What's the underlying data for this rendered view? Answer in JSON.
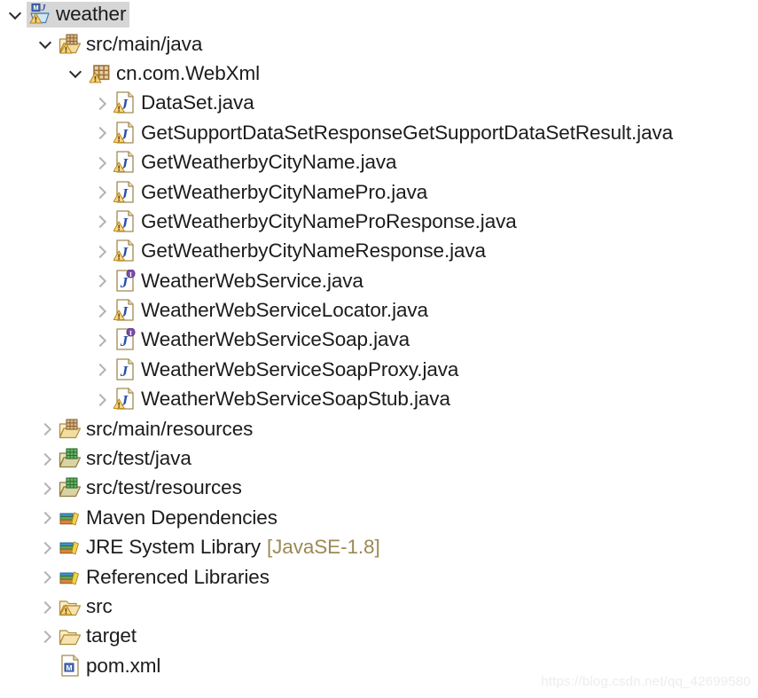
{
  "view": {
    "name": "package-explorer-tree",
    "background": "#ffffff",
    "text_color": "#1c1c1c",
    "selection_color": "#d6d6d6",
    "suffix_color": "#9a8a55"
  },
  "watermark": {
    "text": "https://blog.csdn.net/qq_42699580"
  },
  "tree": [
    {
      "label": "weather",
      "suffix": "",
      "level": 0,
      "twisty": "down",
      "icon": "maven-java-project-warning-icon",
      "selected": true
    },
    {
      "label": "src/main/java",
      "suffix": "",
      "level": 1,
      "twisty": "down",
      "icon": "source-folder-warning-icon",
      "selected": false
    },
    {
      "label": "cn.com.WebXml",
      "suffix": "",
      "level": 2,
      "twisty": "down",
      "icon": "package-warning-icon",
      "selected": false
    },
    {
      "label": "DataSet.java",
      "suffix": "",
      "level": 3,
      "twisty": "right",
      "icon": "java-class-warning-icon",
      "selected": false
    },
    {
      "label": "GetSupportDataSetResponseGetSupportDataSetResult.java",
      "suffix": "",
      "level": 3,
      "twisty": "right",
      "icon": "java-class-warning-icon",
      "selected": false
    },
    {
      "label": "GetWeatherbyCityName.java",
      "suffix": "",
      "level": 3,
      "twisty": "right",
      "icon": "java-class-warning-icon",
      "selected": false
    },
    {
      "label": "GetWeatherbyCityNamePro.java",
      "suffix": "",
      "level": 3,
      "twisty": "right",
      "icon": "java-class-warning-icon",
      "selected": false
    },
    {
      "label": "GetWeatherbyCityNameProResponse.java",
      "suffix": "",
      "level": 3,
      "twisty": "right",
      "icon": "java-class-warning-icon",
      "selected": false
    },
    {
      "label": "GetWeatherbyCityNameResponse.java",
      "suffix": "",
      "level": 3,
      "twisty": "right",
      "icon": "java-class-warning-icon",
      "selected": false
    },
    {
      "label": "WeatherWebService.java",
      "suffix": "",
      "level": 3,
      "twisty": "right",
      "icon": "java-interface-icon",
      "selected": false
    },
    {
      "label": "WeatherWebServiceLocator.java",
      "suffix": "",
      "level": 3,
      "twisty": "right",
      "icon": "java-class-warning-icon",
      "selected": false
    },
    {
      "label": "WeatherWebServiceSoap.java",
      "suffix": "",
      "level": 3,
      "twisty": "right",
      "icon": "java-interface-icon",
      "selected": false
    },
    {
      "label": "WeatherWebServiceSoapProxy.java",
      "suffix": "",
      "level": 3,
      "twisty": "right",
      "icon": "java-class-icon",
      "selected": false
    },
    {
      "label": "WeatherWebServiceSoapStub.java",
      "suffix": "",
      "level": 3,
      "twisty": "right",
      "icon": "java-class-warning-icon",
      "selected": false
    },
    {
      "label": "src/main/resources",
      "suffix": "",
      "level": 1,
      "twisty": "right",
      "icon": "source-folder-resources-icon",
      "selected": false
    },
    {
      "label": "src/test/java",
      "suffix": "",
      "level": 1,
      "twisty": "right",
      "icon": "source-folder-test-icon",
      "selected": false
    },
    {
      "label": "src/test/resources",
      "suffix": "",
      "level": 1,
      "twisty": "right",
      "icon": "source-folder-test-icon",
      "selected": false
    },
    {
      "label": "Maven Dependencies",
      "suffix": "",
      "level": 1,
      "twisty": "right",
      "icon": "library-icon",
      "selected": false
    },
    {
      "label": "JRE System Library",
      "suffix": "[JavaSE-1.8]",
      "level": 1,
      "twisty": "right",
      "icon": "library-icon",
      "selected": false
    },
    {
      "label": "Referenced Libraries",
      "suffix": "",
      "level": 1,
      "twisty": "right",
      "icon": "library-icon",
      "selected": false
    },
    {
      "label": "src",
      "suffix": "",
      "level": 1,
      "twisty": "right",
      "icon": "folder-warning-icon",
      "selected": false
    },
    {
      "label": "target",
      "suffix": "",
      "level": 1,
      "twisty": "right",
      "icon": "folder-icon",
      "selected": false
    },
    {
      "label": "pom.xml",
      "suffix": "",
      "level": 1,
      "twisty": "none",
      "icon": "maven-pom-file-icon",
      "selected": false
    }
  ]
}
